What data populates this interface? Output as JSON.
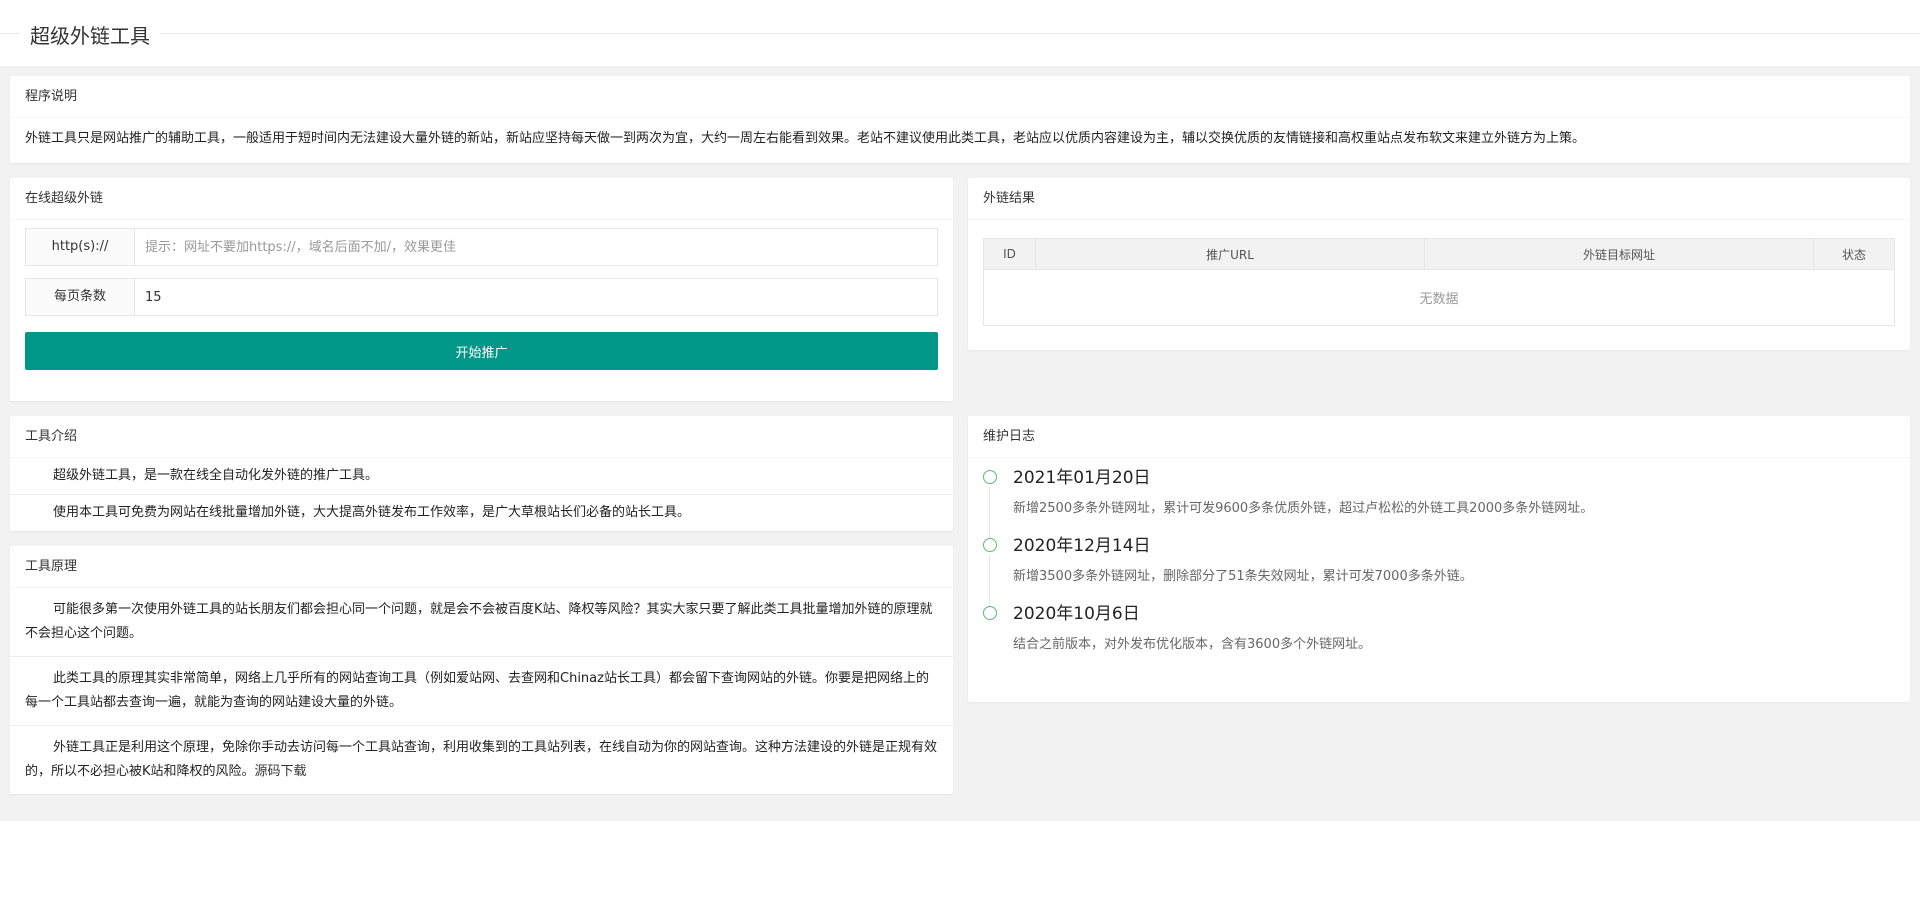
{
  "header": {
    "title": "超级外链工具"
  },
  "desc": {
    "title": "程序说明",
    "text": "外链工具只是网站推广的辅助工具，一般适用于短时间内无法建设大量外链的新站，新站应坚持每天做一到两次为宜，大约一周左右能看到效果。老站不建议使用此类工具，老站应以优质内容建设为主，辅以交换优质的友情链接和高权重站点发布软文来建立外链方为上策。"
  },
  "form": {
    "title": "在线超级外链",
    "url_label": "http(s)://",
    "url_placeholder": "提示：网址不要加https://，域名后面不加/，效果更佳",
    "count_label": "每页条数",
    "count_value": "15",
    "submit_label": "开始推广"
  },
  "results": {
    "title": "外链结果",
    "columns": [
      "ID",
      "推广URL",
      "外链目标网址",
      "状态"
    ],
    "empty": "无数据"
  },
  "intro": {
    "title": "工具介绍",
    "items": [
      "超级外链工具，是一款在线全自动化发外链的推广工具。",
      "使用本工具可免费为网站在线批量增加外链，大大提高外链发布工作效率，是广大草根站长们必备的站长工具。"
    ]
  },
  "principle": {
    "title": "工具原理",
    "items": [
      "可能很多第一次使用外链工具的站长朋友们都会担心同一个问题，就是会不会被百度K站、降权等风险？其实大家只要了解此类工具批量增加外链的原理就不会担心这个问题。",
      "此类工具的原理其实非常简单，网络上几乎所有的网站查询工具（例如爱站网、去查网和Chinaz站长工具）都会留下查询网站的外链。你要是把网络上的每一个工具站都去查询一遍，就能为查询的网站建设大量的外链。",
      "外链工具正是利用这个原理，免除你手动去访问每一个工具站查询，利用收集到的工具站列表，在线自动为你的网站查询。这种方法建设的外链是正规有效的，所以不必担心被K站和降权的风险。"
    ],
    "source_link": "源码下载"
  },
  "log": {
    "title": "维护日志",
    "items": [
      {
        "date": "2021年01月20日",
        "text": "新增2500多条外链网址，累计可发9600多条优质外链，超过卢松松的外链工具2000多条外链网址。"
      },
      {
        "date": "2020年12月14日",
        "text": "新增3500多条外链网址，删除部分了51条失效网址，累计可发7000多条外链。"
      },
      {
        "date": "2020年10月6日",
        "text": "结合之前版本，对外发布优化版本，含有3600多个外链网址。"
      }
    ]
  },
  "colors": {
    "primary": "#009688",
    "timeline_dot": "#5FB878"
  }
}
